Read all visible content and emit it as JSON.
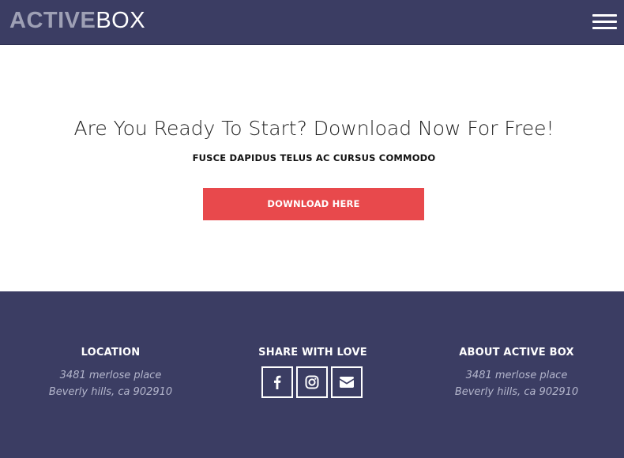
{
  "header": {
    "logo_part1": "ACTIVE",
    "logo_part2": "BOX",
    "menu_icon": "hamburger-menu-icon"
  },
  "hero": {
    "title": "Are You Ready To Start? Download Now For Free!",
    "subtitle": "FUSCE DAPIDUS TELUS AC CURSUS COMMODO",
    "button_label": "DOWNLOAD HERE"
  },
  "footer": {
    "location": {
      "title": "LOCATION",
      "line1": "3481 merlose place",
      "line2": "Beverly hills, ca 902910"
    },
    "share": {
      "title": "SHARE WITH LOVE",
      "icons": [
        "facebook-icon",
        "instagram-icon",
        "envelope-icon"
      ]
    },
    "about": {
      "title": "ABOUT ACTIVE BOX",
      "line1": "3481 merlose place",
      "line2": "Beverly hills, ca 902910"
    }
  },
  "colors": {
    "navy": "#3b3d63",
    "accent_red": "#e8494c",
    "muted_text": "#b4b6cc",
    "logo_grey": "#9ea0b5"
  }
}
